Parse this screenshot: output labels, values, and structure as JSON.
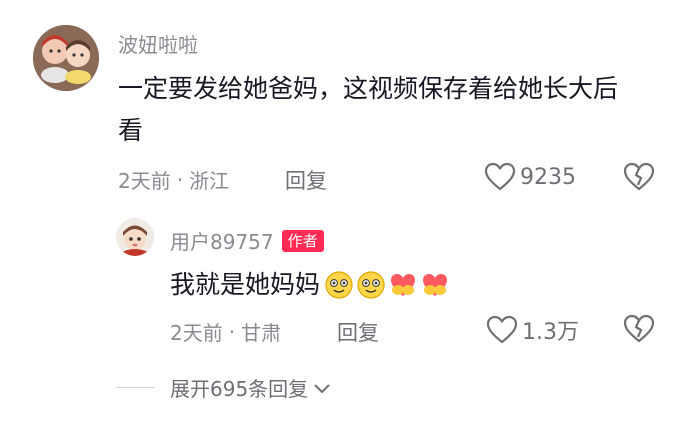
{
  "main_comment": {
    "username": "波妞啦啦",
    "text": "一定要发给她爸妈，这视频保存着给她长大后看",
    "time": "2天前",
    "location": "浙江",
    "reply_label": "回复",
    "like_count": "9235"
  },
  "reply_comment": {
    "username": "用户89757",
    "badge": "作者",
    "text": "我就是她妈妈",
    "time": "2天前",
    "location": "甘肃",
    "reply_label": "回复",
    "like_count": "1.3万"
  },
  "expand_replies": {
    "label": "展开695条回复"
  },
  "colors": {
    "badge": "#fe2c55",
    "meta_gray": "#8a8b91"
  }
}
